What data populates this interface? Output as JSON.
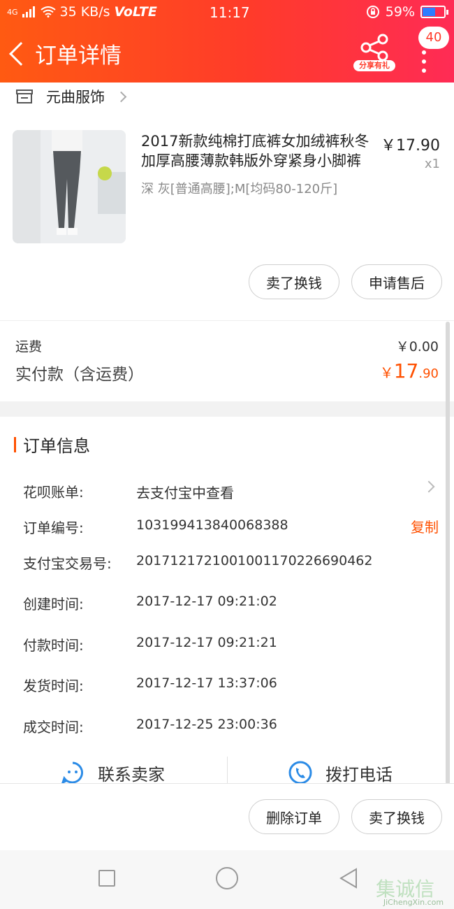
{
  "status_bar": {
    "signal": "4G",
    "speed": "35 KB/s",
    "network": "VoLTE",
    "time": "11:17",
    "battery": "59%",
    "battery_level": 0.59
  },
  "header": {
    "back_label": "订单详情",
    "share_label": "分享有礼",
    "badge_count": "40",
    "brand_color": "#ff3b2a"
  },
  "shop": {
    "name": "元曲服饰"
  },
  "product": {
    "title": "2017新款纯棉打底裤女加绒裤秋冬加厚高腰薄款韩版外穿紧身小脚裤",
    "sku": "深 灰[普通高腰];M[均码80-120斤]",
    "price": "￥17.90",
    "quantity": "x1"
  },
  "actions": {
    "sell_label": "卖了换钱",
    "after_sale_label": "申请售后"
  },
  "totals": {
    "shipping_label": "运费",
    "shipping_value": "￥0.00",
    "paid_label": "实付款（含运费）",
    "paid_currency": "￥",
    "paid_int": "17",
    "paid_dec": ".90",
    "accent_color": "#ff5000"
  },
  "order_info": {
    "title": "订单信息",
    "huabei_label": "花呗账单:",
    "huabei_value": "去支付宝中查看",
    "order_no_label": "订单编号:",
    "order_no_value": "103199413840068388",
    "copy_label": "复制",
    "alipay_label": "支付宝交易号:",
    "alipay_value": "2017121721001001170226690462",
    "created_label": "创建时间:",
    "created_value": "2017-12-17 09:21:02",
    "paid_time_label": "付款时间:",
    "paid_time_value": "2017-12-17 09:21:21",
    "shipped_label": "发货时间:",
    "shipped_value": "2017-12-17 13:37:06",
    "deal_label": "成交时间:",
    "deal_value": "2017-12-25 23:00:36"
  },
  "contact": {
    "seller_label": "联系卖家",
    "phone_label": "拨打电话"
  },
  "bottom_actions": {
    "delete_label": "删除订单",
    "sell_label": "卖了换钱"
  },
  "watermark": {
    "logo": "集诚信",
    "text": "JiChengXin.com"
  }
}
